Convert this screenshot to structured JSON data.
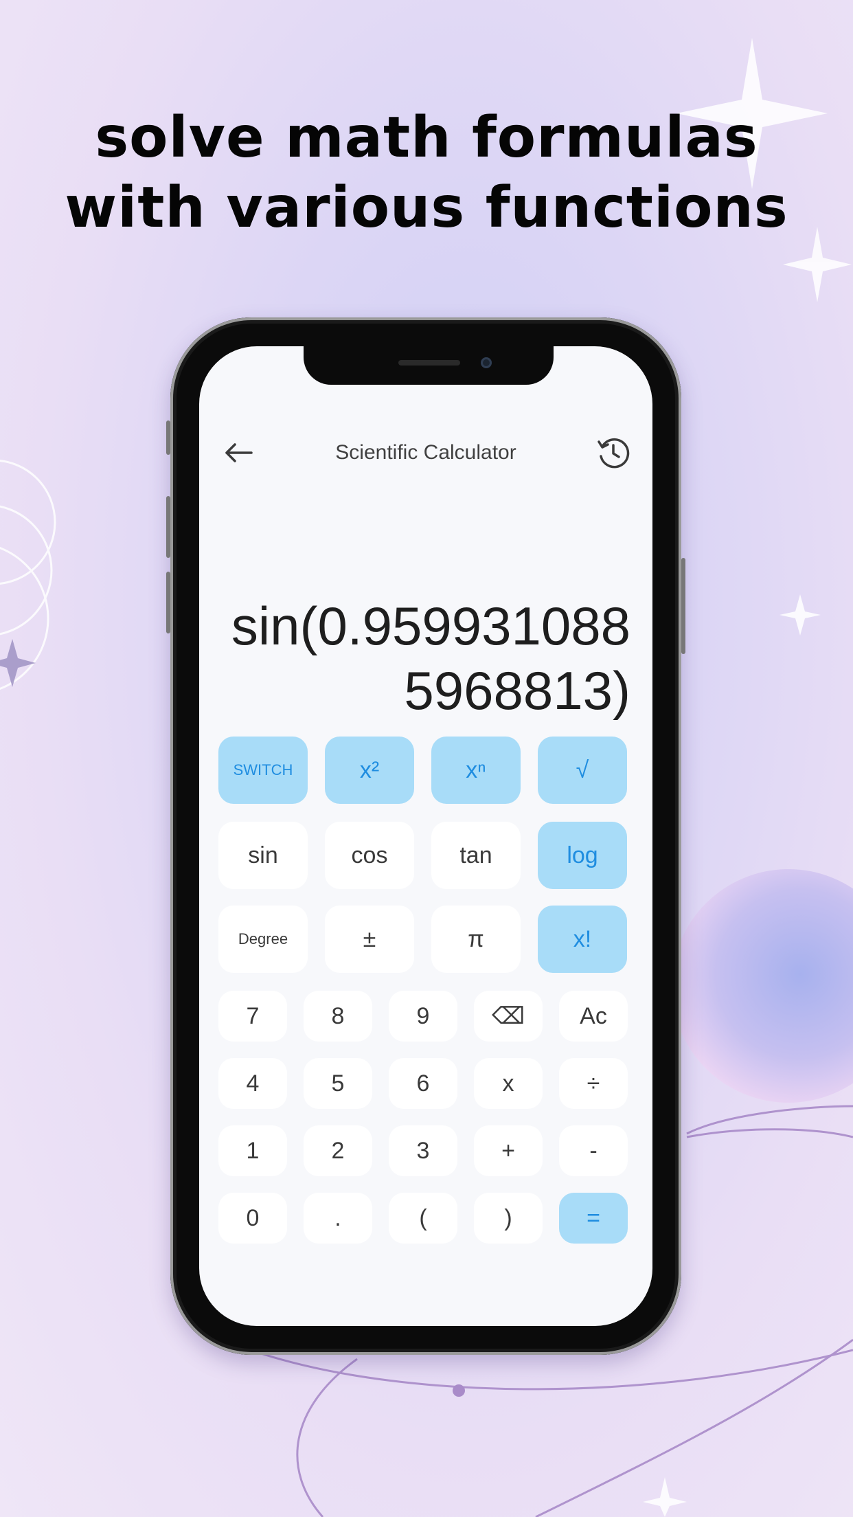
{
  "headline": {
    "line1": "solve math formulas",
    "line2": "with various functions"
  },
  "app": {
    "title": "Scientific Calculator",
    "back_icon": "back-arrow-icon",
    "history_icon": "history-icon"
  },
  "display": {
    "expression": "sin(0.9599310885968813)"
  },
  "keypad": {
    "row1": [
      "SWITCH",
      "x²",
      "xⁿ",
      "√"
    ],
    "row2": [
      "sin",
      "cos",
      "tan",
      "log"
    ],
    "row3": [
      "Degree",
      "±",
      "π",
      "x!"
    ],
    "row4": [
      "7",
      "8",
      "9",
      "⌫",
      "Ac"
    ],
    "row5": [
      "4",
      "5",
      "6",
      "x",
      "÷"
    ],
    "row6": [
      "1",
      "2",
      "3",
      "+",
      "-"
    ],
    "row7": [
      "0",
      ".",
      "(",
      ")",
      "="
    ]
  },
  "colors": {
    "accent_key_bg": "#a8dcf8",
    "accent_key_text": "#1f8de0",
    "background": "#dcd6f5"
  }
}
